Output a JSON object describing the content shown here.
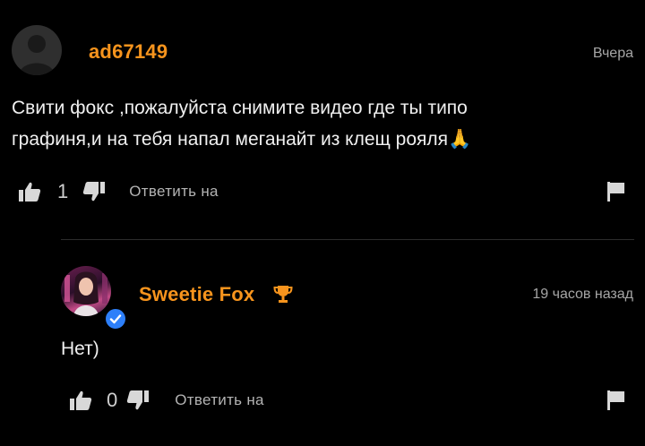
{
  "comment": {
    "author": "ad67149",
    "time": "Вчера",
    "text_line1": "Свити фокс ,пожалуйста снимите видео где ты типо",
    "text_line2": "графиня,и на тебя напал меганайт из клещ рояля",
    "text_emoji": "🙏",
    "likes": "1",
    "reply_label": "Ответить на"
  },
  "reply": {
    "author": "Sweetie Fox",
    "author_badge_icon": "trophy-icon",
    "time": "19 часов назад",
    "text": "Нет)",
    "likes": "0",
    "reply_label": "Ответить на"
  },
  "colors": {
    "background": "#000000",
    "username": "#f7941d",
    "verified": "#2d7ff9",
    "text": "#f0f0f0",
    "muted": "#a6a6a6"
  }
}
